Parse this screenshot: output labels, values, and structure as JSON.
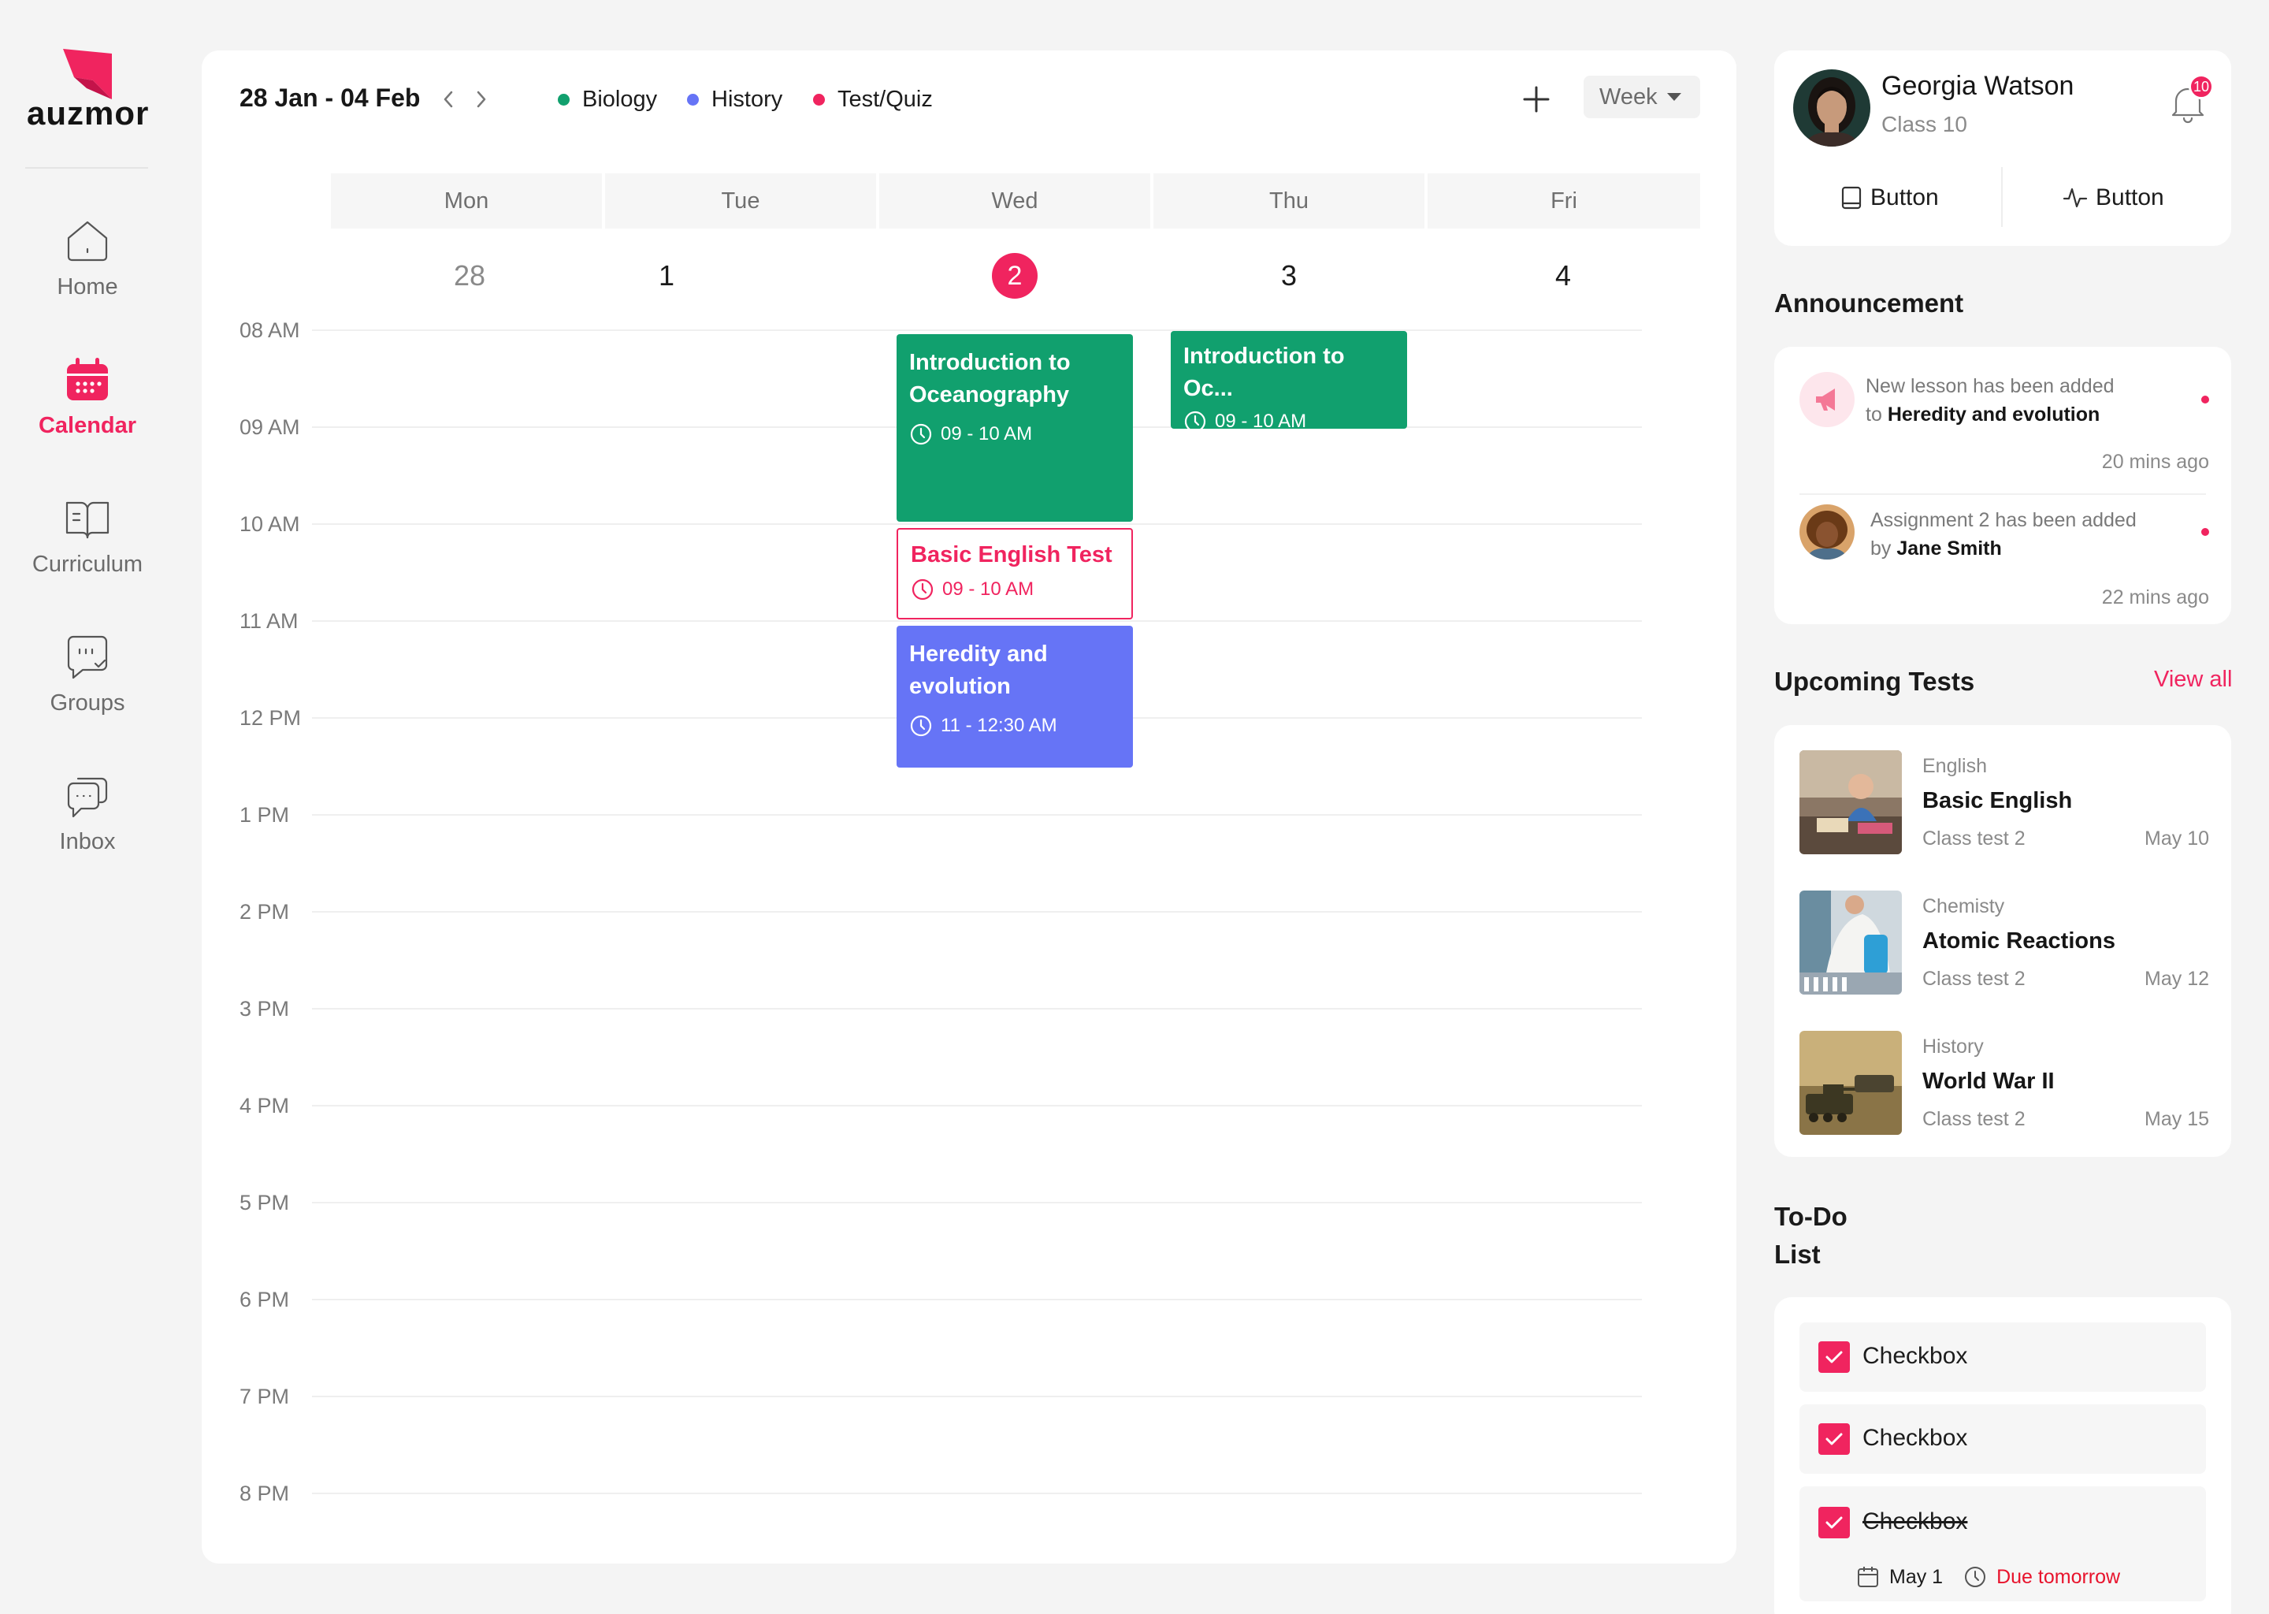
{
  "brand": {
    "name": "auzmor",
    "accent": "#f0245f"
  },
  "sidebar": {
    "items": [
      {
        "label": "Home",
        "icon": "home-icon",
        "active": false
      },
      {
        "label": "Calendar",
        "icon": "calendar-icon",
        "active": true
      },
      {
        "label": "Curriculum",
        "icon": "book-icon",
        "active": false
      },
      {
        "label": "Groups",
        "icon": "groups-icon",
        "active": false
      },
      {
        "label": "Inbox",
        "icon": "inbox-icon",
        "active": false
      }
    ]
  },
  "calendar": {
    "date_range": "28 Jan - 04 Feb",
    "legend": [
      {
        "label": "Biology",
        "color": "#11a06e"
      },
      {
        "label": "History",
        "color": "#6674f6"
      },
      {
        "label": "Test/Quiz",
        "color": "#f0245f"
      }
    ],
    "view_select": "Week",
    "days": [
      {
        "name": "Mon",
        "num": "28"
      },
      {
        "name": "Tue",
        "num": "1"
      },
      {
        "name": "Wed",
        "num": "2"
      },
      {
        "name": "Thu",
        "num": "3"
      },
      {
        "name": "Fri",
        "num": "4"
      }
    ],
    "times": [
      "08 AM",
      "09 AM",
      "10 AM",
      "11 AM",
      "12 PM",
      "1 PM",
      "2 PM",
      "3 PM",
      "4 PM",
      "5 PM",
      "6 PM",
      "7 PM",
      "8 PM"
    ],
    "events": [
      {
        "title": "Introduction to Oceanography",
        "time": "09 - 10 AM",
        "category": "Biology"
      },
      {
        "title": "Basic English Test",
        "time": "09 - 10 AM",
        "category": "Test/Quiz"
      },
      {
        "title": "Heredity and evolution",
        "time": "11 - 12:30 AM",
        "category": "History"
      },
      {
        "title": "Introduction to Oc...",
        "time": "09 - 10 AM",
        "category": "Biology"
      }
    ]
  },
  "profile": {
    "name": "Georgia Watson",
    "class": "Class 10",
    "notifications": "10",
    "button1": "Button",
    "button2": "Button"
  },
  "announcement": {
    "title": "Announcement",
    "items": [
      {
        "text": "New lesson has been added",
        "prefix": "to",
        "bold": "Heredity and evolution",
        "time": "20 mins ago"
      },
      {
        "text": "Assignment 2 has been added",
        "prefix": "by",
        "bold": "Jane Smith",
        "time": "22 mins ago"
      }
    ]
  },
  "tests": {
    "title": "Upcoming Tests",
    "view_all": "View all",
    "items": [
      {
        "subject": "English",
        "name": "Basic English",
        "class": "Class test 2",
        "date": "May 10"
      },
      {
        "subject": "Chemisty",
        "name": "Atomic Reactions",
        "class": "Class test 2",
        "date": "May 12"
      },
      {
        "subject": "History",
        "name": "World War II",
        "class": "Class test 2",
        "date": "May 15"
      }
    ]
  },
  "todo": {
    "title_line1": "To-Do",
    "title_line2": "List",
    "items": [
      {
        "label": "Checkbox",
        "done": false
      },
      {
        "label": "Checkbox",
        "done": false
      },
      {
        "label": "Checkbox",
        "done": true,
        "date": "May 1",
        "due": "Due tomorrow"
      }
    ]
  }
}
